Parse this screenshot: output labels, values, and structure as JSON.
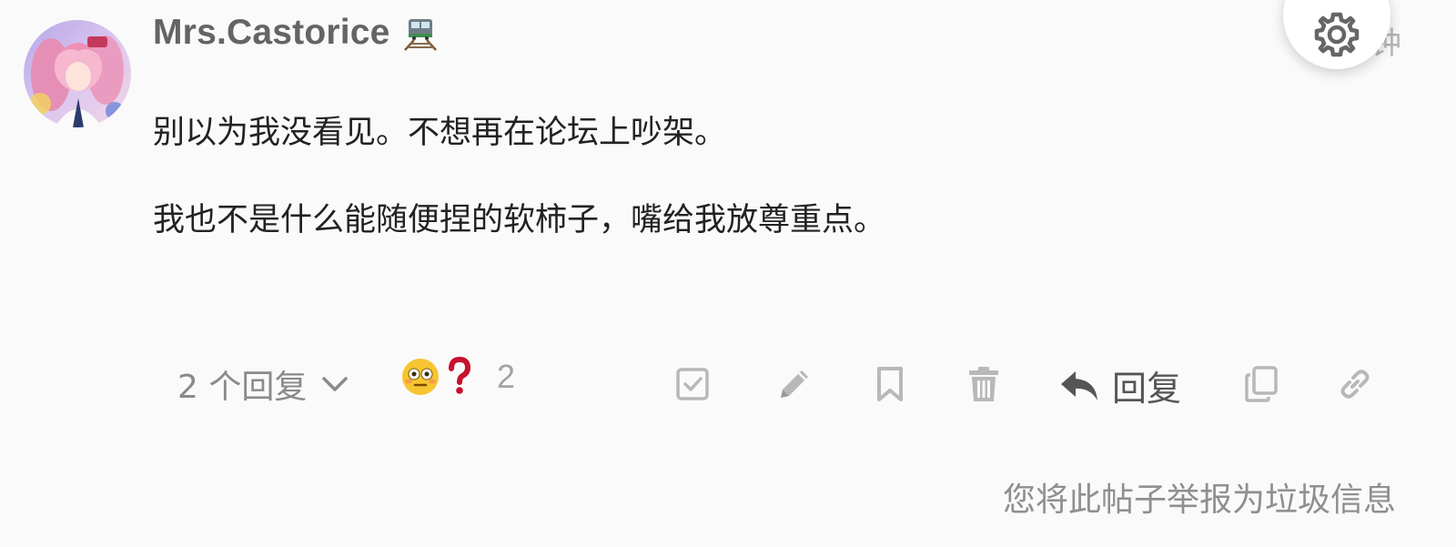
{
  "post": {
    "author": {
      "username": "Mrs.Castorice",
      "flair_icon": "railway-track-icon",
      "avatar_icon": "anime-avatar"
    },
    "date": "7 分钟",
    "body": [
      "别以为我没看见。不想再在论坛上吵架。",
      "我也不是什么能随便捏的软柿子，嘴给我放尊重点。"
    ]
  },
  "actions": {
    "replies_label": "2 个回复",
    "reaction": {
      "emojis": [
        "flushed-face-icon",
        "question-mark-icon"
      ],
      "count": "2"
    },
    "reply_label": "回复",
    "icons": [
      "checkbox-icon",
      "pencil-icon",
      "bookmark-icon",
      "trash-icon",
      "reply-arrow-icon",
      "copy-icon",
      "link-icon"
    ]
  },
  "flag_notice": "您将此帖子举报为垃圾信息",
  "colors": {
    "background": "#fafafa",
    "username": "#646464",
    "body_text": "#222222",
    "muted": "#8a8a8a",
    "icon_light": "#b8b8b8",
    "question_red": "#c8102e"
  }
}
